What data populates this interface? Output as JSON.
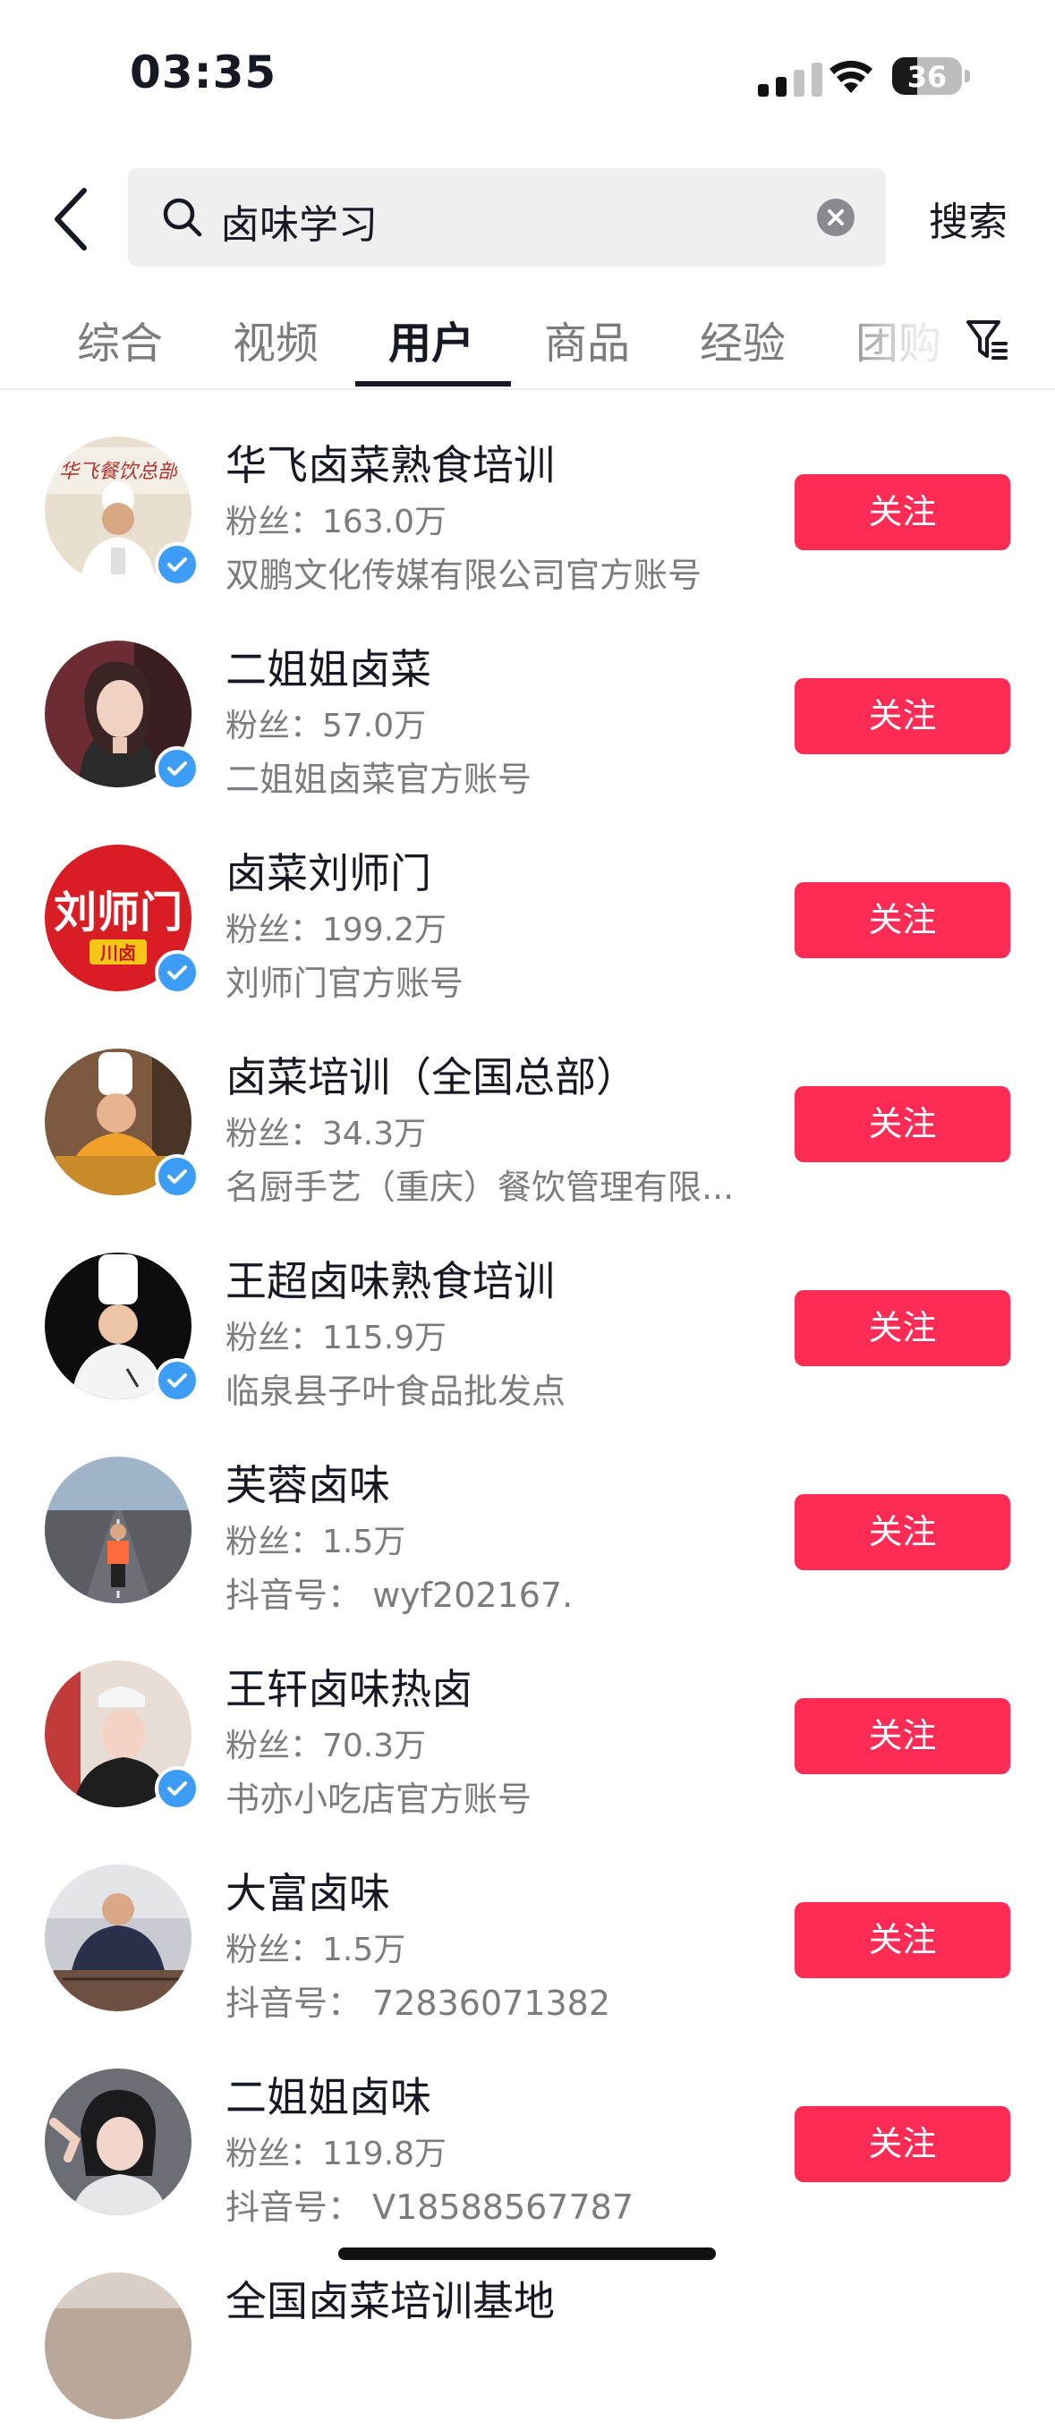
{
  "status": {
    "time": "03:35",
    "battery": "36"
  },
  "search": {
    "query": "卤味学习",
    "button_label": "搜索"
  },
  "tabs": [
    {
      "label": "综合",
      "active": false
    },
    {
      "label": "视频",
      "active": false
    },
    {
      "label": "用户",
      "active": true
    },
    {
      "label": "商品",
      "active": false
    },
    {
      "label": "经验",
      "active": false
    },
    {
      "label": "团购",
      "active": false
    }
  ],
  "colors": {
    "follow_bg": "#fe2c55",
    "verified": "#3d9cf5",
    "accent_text": "#161823"
  },
  "users": [
    {
      "name": "华飞卤菜熟食培训",
      "fans": "粉丝：163.0万",
      "desc": "双鹏文化传媒有限公司官方账号",
      "verified": true,
      "follow": "关注"
    },
    {
      "name": "二姐姐卤菜",
      "fans": "粉丝：57.0万",
      "desc": "二姐姐卤菜官方账号",
      "verified": true,
      "follow": "关注"
    },
    {
      "name": "卤菜刘师门",
      "fans": "粉丝：199.2万",
      "desc": "刘师门官方账号",
      "verified": true,
      "follow": "关注",
      "avatar_text": "刘师门",
      "avatar_tag": "川卤"
    },
    {
      "name": "卤菜培训（全国总部）",
      "fans": "粉丝：34.3万",
      "desc": "名厨手艺（重庆）餐饮管理有限...",
      "verified": true,
      "follow": "关注"
    },
    {
      "name": "王超卤味熟食培训",
      "fans": "粉丝：115.9万",
      "desc": "临泉县子叶食品批发点",
      "verified": true,
      "follow": "关注"
    },
    {
      "name": "芙蓉卤味",
      "fans": "粉丝：1.5万",
      "desc": "抖音号： wyf202167.",
      "verified": false,
      "follow": "关注"
    },
    {
      "name": "王轩卤味热卤",
      "fans": "粉丝：70.3万",
      "desc": "书亦小吃店官方账号",
      "verified": true,
      "follow": "关注"
    },
    {
      "name": "大富卤味",
      "fans": "粉丝：1.5万",
      "desc": "抖音号： 72836071382",
      "verified": false,
      "follow": "关注"
    },
    {
      "name": "二姐姐卤味",
      "fans": "粉丝：119.8万",
      "desc": "抖音号： V18588567787",
      "verified": false,
      "follow": "关注"
    },
    {
      "name": "全国卤菜培训基地",
      "fans": "",
      "desc": "",
      "verified": false,
      "follow": ""
    }
  ]
}
